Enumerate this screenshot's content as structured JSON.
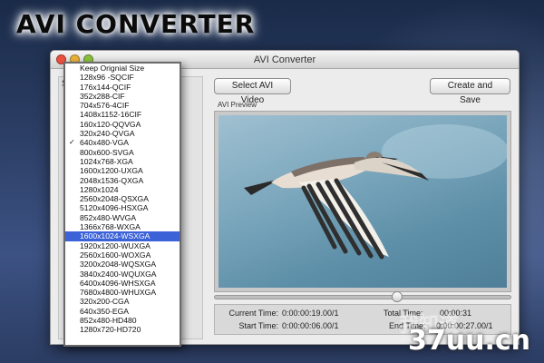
{
  "banner": {
    "title": "AVI CONVERTER"
  },
  "window": {
    "title": "AVI Converter"
  },
  "left_panel": {
    "label": "S"
  },
  "toolbar": {
    "select_label": "Select AVI Video",
    "save_label": "Create and Save"
  },
  "preview": {
    "label": "AVI Preview"
  },
  "timeline": {
    "position": 0.62
  },
  "times": {
    "current_label": "Current Time:",
    "current_value": "0:00:00:19.00/1",
    "total_label": "Total Time:",
    "total_value": "00:00:31",
    "start_label": "Start Time:",
    "start_value": "0:00:00:06.00/1",
    "end_label": "End Time:",
    "end_value": "0:00:00:27.00/1"
  },
  "dropdown": {
    "checked_index": 8,
    "selected_index": 18,
    "items": [
      "Keep Orignial Size",
      "128x96 -SQCIF",
      "176x144-QCIF",
      "352x288-CIF",
      "704x576-4CIF",
      "1408x1152-16CIF",
      "160x120-QQVGA",
      "320x240-QVGA",
      "640x480-VGA",
      "800x600-SVGA",
      "1024x768-XGA",
      "1600x1200-UXGA",
      "2048x1536-QXGA",
      "1280x1024",
      "2560x2048-QSXGA",
      "5120x4096-HSXGA",
      "852x480-WVGA",
      "1366x768-WXGA",
      "1600x1024-WSXGA",
      "1920x1200-WUXGA",
      "2560x1600-WOXGA",
      "3200x2048-WQSXGA",
      "3840x2400-WQUXGA",
      "6400x4096-WHSXGA",
      "7680x4800-WHUXGA",
      "320x200-CGA",
      "640x350-EGA",
      "852x480-HD480",
      "1280x720-HD720"
    ]
  },
  "watermark": {
    "top_text": "我知道",
    "text": "37uu.cn"
  }
}
